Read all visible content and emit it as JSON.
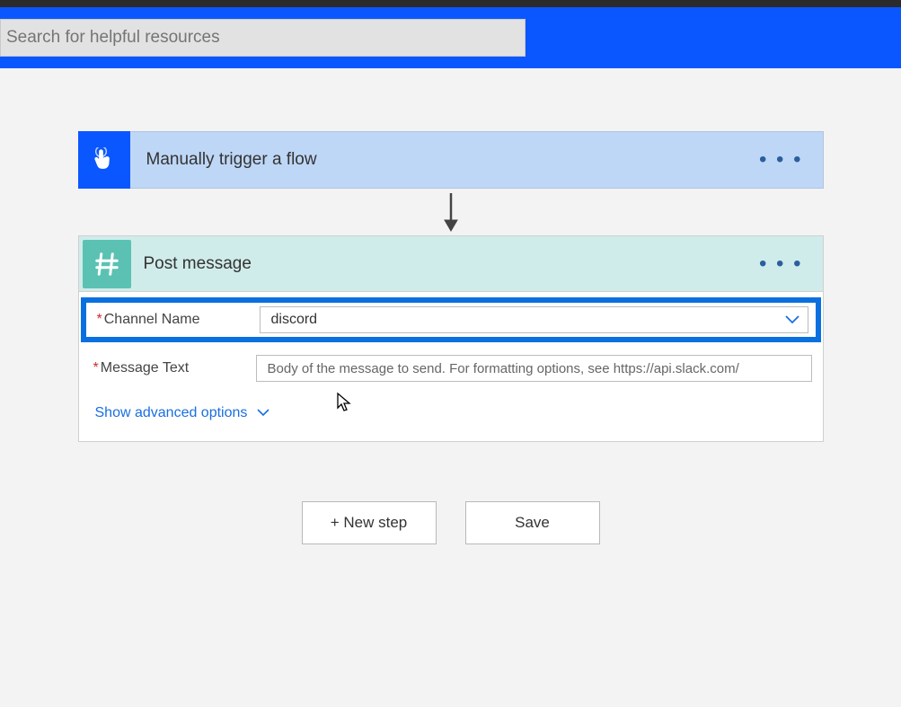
{
  "search": {
    "placeholder": "Search for helpful resources"
  },
  "trigger": {
    "title": "Manually trigger a flow"
  },
  "action": {
    "title": "Post message",
    "fields": {
      "channel": {
        "label": "Channel Name",
        "value": "discord"
      },
      "message": {
        "label": "Message Text",
        "placeholder": "Body of the message to send. For formatting options, see https://api.slack.com/"
      }
    },
    "advanced_link": "Show advanced options"
  },
  "buttons": {
    "new_step": "+ New step",
    "save": "Save"
  }
}
